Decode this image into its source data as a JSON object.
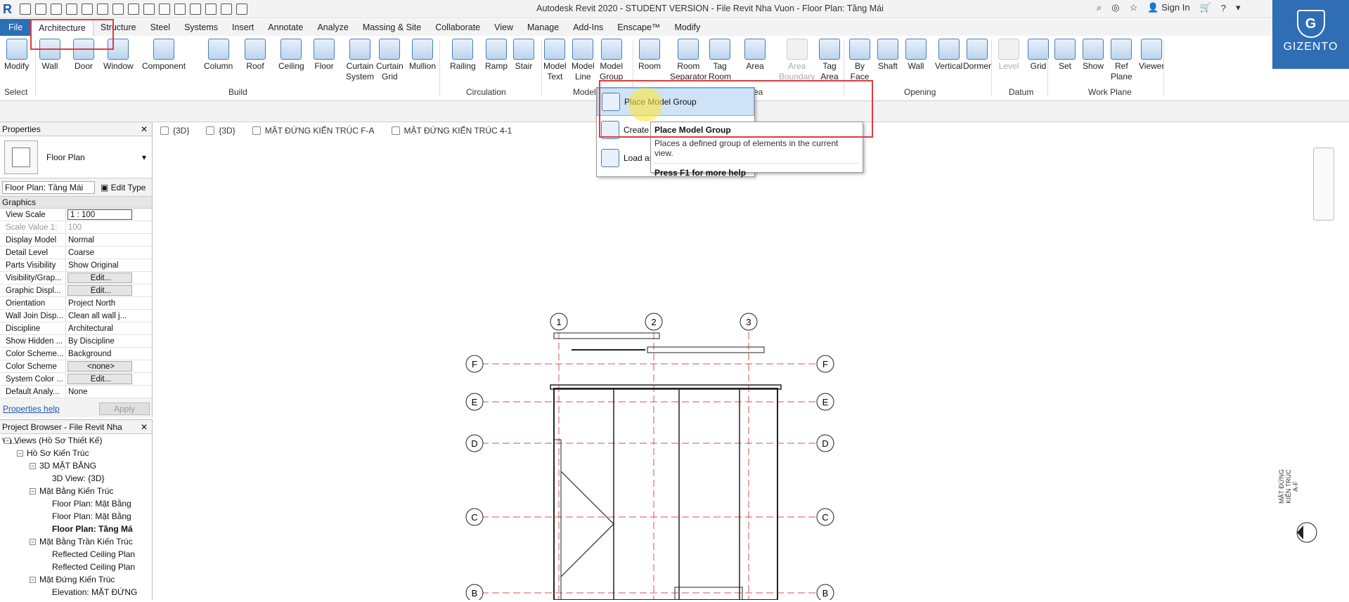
{
  "titlebar": {
    "title": "Autodesk Revit 2020 - STUDENT VERSION - File Revit Nha Vuon - Floor Plan: Tầng Mái",
    "sign_in": "Sign In"
  },
  "tabs": [
    "File",
    "Architecture",
    "Structure",
    "Steel",
    "Systems",
    "Insert",
    "Annotate",
    "Analyze",
    "Massing & Site",
    "Collaborate",
    "View",
    "Manage",
    "Add-Ins",
    "Enscape™",
    "Modify"
  ],
  "ribbon": {
    "select": {
      "modify": "Modify",
      "group": "Select"
    },
    "build": {
      "items": [
        "Wall",
        "Door",
        "Window",
        "Component",
        "Column",
        "Roof",
        "Ceiling",
        "Floor",
        "Curtain\nSystem",
        "Curtain\nGrid",
        "Mullion"
      ],
      "group": "Build"
    },
    "circulation": {
      "items": [
        "Railing",
        "Ramp",
        "Stair"
      ],
      "group": "Circulation"
    },
    "model": {
      "items": [
        "Model\nText",
        "Model\nLine",
        "Model\nGroup"
      ],
      "group": "Model"
    },
    "room": {
      "items": [
        "Room",
        "Room\nSeparator",
        "Tag\nRoom",
        "Area",
        "Area\nBoundary",
        "Tag\nArea"
      ],
      "group_suffix": "ea"
    },
    "opening": {
      "items": [
        "By\nFace",
        "Shaft",
        "Wall",
        "Vertical",
        "Dormer"
      ],
      "group": "Opening"
    },
    "datum": {
      "items": [
        "Level",
        "Grid"
      ],
      "group": "Datum"
    },
    "workplane": {
      "items": [
        "Set",
        "Show",
        "Ref\nPlane",
        "Viewer"
      ],
      "group": "Work Plane"
    }
  },
  "logo": {
    "name": "GIZENTO",
    "letter": "G"
  },
  "properties": {
    "title": "Properties",
    "type": "Floor Plan",
    "selector": "Floor Plan: Tầng Mái",
    "edit_type": "Edit Type",
    "category": "Graphics",
    "rows": [
      {
        "k": "View Scale",
        "v": "1 : 100"
      },
      {
        "k": "Scale Value    1:",
        "v": "100"
      },
      {
        "k": "Display Model",
        "v": "Normal"
      },
      {
        "k": "Detail Level",
        "v": "Coarse"
      },
      {
        "k": "Parts Visibility",
        "v": "Show Original"
      },
      {
        "k": "Visibility/Grap...",
        "v": "Edit..."
      },
      {
        "k": "Graphic Displ...",
        "v": "Edit..."
      },
      {
        "k": "Orientation",
        "v": "Project North"
      },
      {
        "k": "Wall Join Disp...",
        "v": "Clean all wall j..."
      },
      {
        "k": "Discipline",
        "v": "Architectural"
      },
      {
        "k": "Show Hidden ...",
        "v": "By Discipline"
      },
      {
        "k": "Color Scheme...",
        "v": "Background"
      },
      {
        "k": "Color Scheme",
        "v": "<none>"
      },
      {
        "k": "System Color ...",
        "v": "Edit..."
      },
      {
        "k": "Default Analy...",
        "v": "None"
      }
    ],
    "help": "Properties help",
    "apply": "Apply"
  },
  "browser": {
    "title": "Project Browser - File Revit Nha Vu...",
    "nodes": [
      {
        "t": "Views (Hồ Sơ Thiết Kế)",
        "lvl": 0,
        "tog": "−"
      },
      {
        "t": "Hồ Sơ Kiến Trúc",
        "lvl": 1,
        "tog": "−"
      },
      {
        "t": "3D MẶT BẰNG",
        "lvl": 2,
        "tog": "−"
      },
      {
        "t": "3D View: {3D}",
        "lvl": 3,
        "tog": ""
      },
      {
        "t": "Mặt Bằng Kiến Trúc",
        "lvl": 2,
        "tog": "−"
      },
      {
        "t": "Floor Plan: Mặt Bằng",
        "lvl": 3,
        "tog": ""
      },
      {
        "t": "Floor Plan: Mặt Bằng",
        "lvl": 3,
        "tog": ""
      },
      {
        "t": "Floor Plan: Tầng Má",
        "lvl": 3,
        "tog": "",
        "bold": true
      },
      {
        "t": "Mặt Bằng Trần Kiến Trúc",
        "lvl": 2,
        "tog": "−"
      },
      {
        "t": "Reflected Ceiling Plan",
        "lvl": 3,
        "tog": ""
      },
      {
        "t": "Reflected Ceiling Plan",
        "lvl": 3,
        "tog": ""
      },
      {
        "t": "Mặt Đứng Kiến Trúc",
        "lvl": 2,
        "tog": "−"
      },
      {
        "t": "Elevation: MẶT ĐỨNG",
        "lvl": 3,
        "tog": ""
      }
    ]
  },
  "view_tabs": [
    "{3D}",
    "{3D}",
    "MẶT ĐỨNG KIẾN TRÚC F-A",
    "MẶT ĐỨNG KIẾN TRÚC 4-1"
  ],
  "dropdown": {
    "items": [
      "Place Model Group",
      "Create",
      "Load as"
    ]
  },
  "tooltip": {
    "title": "Place Model Group",
    "desc": "Places a defined group of elements in the current view.",
    "help": "Press F1 for more help"
  },
  "grid": {
    "cols": [
      "1",
      "2",
      "3"
    ],
    "rows": [
      "F",
      "E",
      "D",
      "C",
      "B"
    ]
  },
  "elevation_tag": {
    "text": "MẶT ĐỨNG\nKIẾN TRÚC\nA-F"
  }
}
